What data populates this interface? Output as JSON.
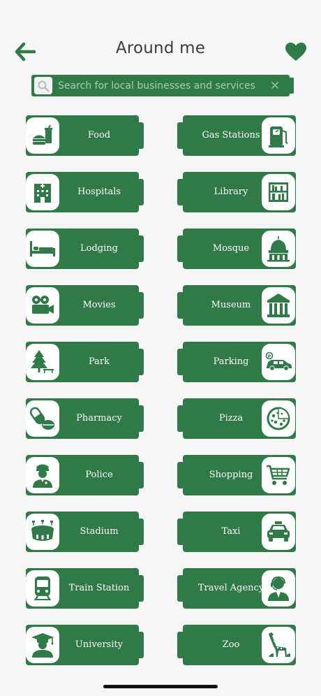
{
  "header": {
    "title": "Around me",
    "back_icon": "arrow-left-icon",
    "favorite_icon": "heart-icon"
  },
  "search": {
    "placeholder": "Search for local businesses and services",
    "value": "",
    "icon": "magnifier-icon",
    "clear_icon": "close-icon"
  },
  "colors": {
    "accent": "#2f7a46",
    "background": "#f6f6f6",
    "text_light": "#ffffff",
    "title": "#3c3c3c"
  },
  "categories": [
    {
      "label": "Food",
      "icon": "food-icon"
    },
    {
      "label": "Gas Stations",
      "icon": "gas-pump-icon"
    },
    {
      "label": "Hospitals",
      "icon": "hospital-icon"
    },
    {
      "label": "Library",
      "icon": "bookshelf-icon"
    },
    {
      "label": "Lodging",
      "icon": "bed-icon"
    },
    {
      "label": "Mosque",
      "icon": "mosque-icon"
    },
    {
      "label": "Movies",
      "icon": "film-camera-icon"
    },
    {
      "label": "Museum",
      "icon": "museum-icon"
    },
    {
      "label": "Park",
      "icon": "tree-icon"
    },
    {
      "label": "Parking",
      "icon": "car-parking-icon"
    },
    {
      "label": "Pharmacy",
      "icon": "pills-icon"
    },
    {
      "label": "Pizza",
      "icon": "pizza-icon"
    },
    {
      "label": "Police",
      "icon": "police-officer-icon"
    },
    {
      "label": "Shopping",
      "icon": "shopping-cart-icon"
    },
    {
      "label": "Stadium",
      "icon": "stadium-icon"
    },
    {
      "label": "Taxi",
      "icon": "taxi-icon"
    },
    {
      "label": "Train Station",
      "icon": "train-icon"
    },
    {
      "label": "Travel Agency",
      "icon": "travel-agent-icon"
    },
    {
      "label": "University",
      "icon": "graduate-icon"
    },
    {
      "label": "Zoo",
      "icon": "giraffe-icon"
    }
  ]
}
